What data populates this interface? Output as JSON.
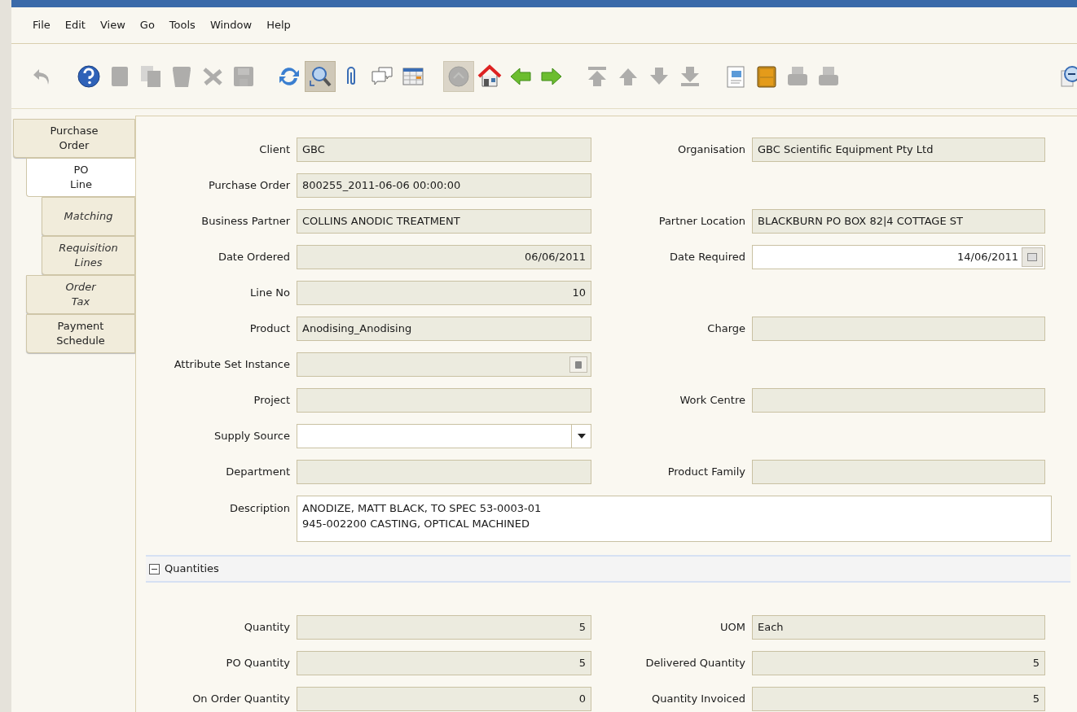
{
  "menu": [
    {
      "label": "File"
    },
    {
      "label": "Edit"
    },
    {
      "label": "View"
    },
    {
      "label": "Go"
    },
    {
      "label": "Tools"
    },
    {
      "label": "Window"
    },
    {
      "label": "Help"
    }
  ],
  "toolbar": [
    [
      {
        "kind": "undo",
        "disabled": true,
        "pressed": false
      }
    ],
    [
      {
        "kind": "help",
        "disabled": false,
        "pressed": false
      },
      {
        "kind": "new",
        "disabled": true,
        "pressed": false
      },
      {
        "kind": "copy",
        "disabled": true,
        "pressed": false
      },
      {
        "kind": "delete",
        "disabled": true,
        "pressed": false
      },
      {
        "kind": "delete-selection",
        "disabled": true,
        "pressed": false
      },
      {
        "kind": "save",
        "disabled": true,
        "pressed": false
      }
    ],
    [
      {
        "kind": "refresh",
        "disabled": false,
        "pressed": false
      },
      {
        "kind": "find",
        "disabled": false,
        "pressed": true
      },
      {
        "kind": "attachment",
        "disabled": false,
        "pressed": false
      },
      {
        "kind": "chat",
        "disabled": false,
        "pressed": false
      },
      {
        "kind": "grid",
        "disabled": false,
        "pressed": false
      }
    ],
    [
      {
        "kind": "history",
        "disabled": true,
        "pressed": true
      },
      {
        "kind": "home",
        "disabled": false,
        "pressed": false
      },
      {
        "kind": "back",
        "disabled": false,
        "pressed": false
      },
      {
        "kind": "forward",
        "disabled": false,
        "pressed": false
      }
    ],
    [
      {
        "kind": "first",
        "disabled": true,
        "pressed": false
      },
      {
        "kind": "up",
        "disabled": true,
        "pressed": false
      },
      {
        "kind": "down",
        "disabled": true,
        "pressed": false
      },
      {
        "kind": "last",
        "disabled": true,
        "pressed": false
      }
    ],
    [
      {
        "kind": "report",
        "disabled": false,
        "pressed": false
      },
      {
        "kind": "archive",
        "disabled": false,
        "pressed": false
      },
      {
        "kind": "print-preview",
        "disabled": true,
        "pressed": false
      },
      {
        "kind": "print",
        "disabled": true,
        "pressed": false
      }
    ],
    [
      {
        "kind": "zoom-across",
        "disabled": false,
        "pressed": false
      }
    ]
  ],
  "tabs": [
    {
      "label": "Purchase Order",
      "selected": false,
      "inactive": false,
      "children": [
        {
          "label": "PO Line",
          "selected": true,
          "inactive": false,
          "children": [
            {
              "label": "Matching",
              "selected": false,
              "inactive": true
            },
            {
              "label": "Requisition Lines",
              "selected": false,
              "inactive": true
            }
          ]
        },
        {
          "label": "Order Tax",
          "selected": false,
          "inactive": true
        },
        {
          "label": "Payment Schedule",
          "selected": false,
          "inactive": false
        }
      ]
    }
  ],
  "rows": [
    {
      "left": {
        "label": "Client",
        "kind": "text",
        "value": "GBC",
        "readonly": true
      },
      "right": {
        "label": "Organisation",
        "kind": "text",
        "value": "GBC Scientific Equipment Pty Ltd",
        "readonly": true
      }
    },
    {
      "left": {
        "label": "Purchase Order",
        "kind": "text",
        "value": "800255_2011-06-06 00:00:00",
        "readonly": true
      }
    },
    {
      "left": {
        "label": "Business Partner",
        "kind": "text",
        "value": "COLLINS ANODIC TREATMENT",
        "readonly": true
      },
      "right": {
        "label": "Partner Location",
        "kind": "text",
        "value": "BLACKBURN PO BOX 82|4 COTTAGE ST",
        "readonly": true
      }
    },
    {
      "left": {
        "label": "Date Ordered",
        "kind": "number",
        "value": "06/06/2011",
        "readonly": true
      },
      "right": {
        "label": "Date Required",
        "kind": "date",
        "value": "14/06/2011",
        "readonly": false
      }
    },
    {
      "left": {
        "label": "Line No",
        "kind": "number",
        "value": "10",
        "readonly": true
      }
    },
    {
      "left": {
        "label": "Product",
        "kind": "text",
        "value": "Anodising_Anodising",
        "readonly": true
      },
      "right": {
        "label": "Charge",
        "kind": "text",
        "readonly": true
      }
    },
    {
      "left": {
        "label": "Attribute Set Instance",
        "kind": "lookup",
        "readonly": true
      }
    },
    {
      "left": {
        "label": "Project",
        "kind": "text",
        "readonly": true
      },
      "right": {
        "label": "Work Centre",
        "kind": "text",
        "readonly": true
      }
    },
    {
      "left": {
        "label": "Supply Source",
        "kind": "select",
        "readonly": false
      }
    },
    {
      "left": {
        "label": "Department",
        "kind": "text",
        "readonly": true
      },
      "right": {
        "label": "Product Family",
        "kind": "text",
        "readonly": true
      }
    },
    {
      "full": {
        "label": "Description",
        "kind": "textarea",
        "value": "ANODIZE, MATT BLACK, TO SPEC 53-0003-01\n945-002200 CASTING, OPTICAL MACHINED",
        "readonly": false
      }
    }
  ],
  "section": {
    "title": "Quantities",
    "expanded": true,
    "rows": [
      {
        "left": {
          "label": "Quantity",
          "kind": "number",
          "value": "5",
          "readonly": true
        },
        "right": {
          "label": "UOM",
          "kind": "text",
          "value": "Each",
          "readonly": true
        }
      },
      {
        "left": {
          "label": "PO Quantity",
          "kind": "number",
          "value": "5",
          "readonly": true
        },
        "right": {
          "label": "Delivered Quantity",
          "kind": "number",
          "value": "5",
          "readonly": true
        }
      },
      {
        "left": {
          "label": "On Order Quantity",
          "kind": "number",
          "value": "0",
          "readonly": true
        },
        "right": {
          "label": "Quantity Invoiced",
          "kind": "number",
          "value": "5",
          "readonly": true
        }
      }
    ]
  }
}
